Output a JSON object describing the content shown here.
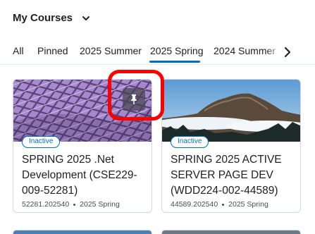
{
  "header": {
    "title": "My Courses"
  },
  "tabs": [
    {
      "label": "All"
    },
    {
      "label": "Pinned"
    },
    {
      "label": "2025 Summer"
    },
    {
      "label": "2025 Spring"
    },
    {
      "label": "2024 Summer"
    }
  ],
  "active_tab": "2025 Spring",
  "courses": [
    {
      "status": "Inactive",
      "title": "SPRING 2025 .Net Development (CSE229-009-52281)",
      "code": "52281.202540",
      "term": "2025 Spring"
    },
    {
      "status": "Inactive",
      "title": "SPRING 2025 ACTIVE SERVER PAGE DEV (WDD224-002-44589)",
      "code": "44589.202540",
      "term": "2025 Spring"
    }
  ],
  "colors": {
    "accent": "#006fbf",
    "highlight": "#ff0000"
  },
  "icons": {
    "header": "chevron-down-icon",
    "tabs_next": "chevron-right-icon",
    "pin": "pin-icon"
  }
}
